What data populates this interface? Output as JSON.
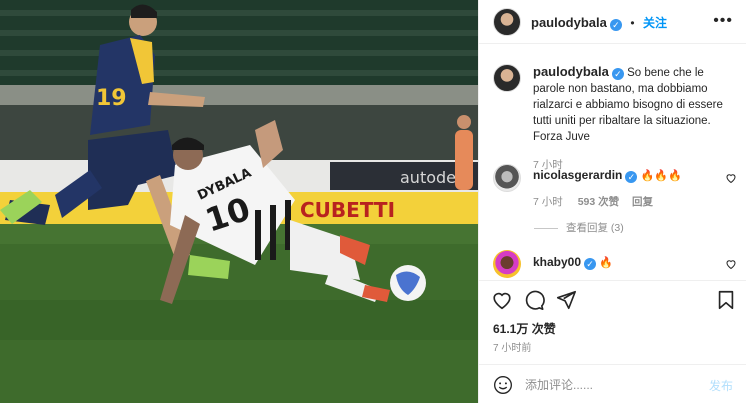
{
  "photo": {
    "player_front": {
      "name": "DYBALA",
      "number": "10"
    },
    "player_back": {
      "number": "19"
    },
    "banner_text_right": "autodel",
    "banner_text_mid": "CUBETTI"
  },
  "header": {
    "username": "paulodybala",
    "verified_mark": "✓",
    "dot": "•",
    "follow_label": "关注",
    "more_icon": "•••"
  },
  "caption": {
    "username": "paulodybala",
    "text": "So bene che le parole non bastano, ma dobbiamo rialzarci e abbiamo bisogno di essere tutti uniti per ribaltare la situazione. Forza Juve",
    "time": "7 小时"
  },
  "comments": [
    {
      "username": "nicolasgerardin",
      "text": "🔥🔥🔥",
      "time": "7 小时",
      "likes": "593 次赞",
      "reply": "回复"
    },
    {
      "username": "khaby00",
      "text": "🔥"
    }
  ],
  "view_replies": "查看回复 (3)",
  "likes_count": "61.1万 次赞",
  "post_time": "7 小时前",
  "comment_input": {
    "placeholder": "添加评论......",
    "post_label": "发布"
  }
}
